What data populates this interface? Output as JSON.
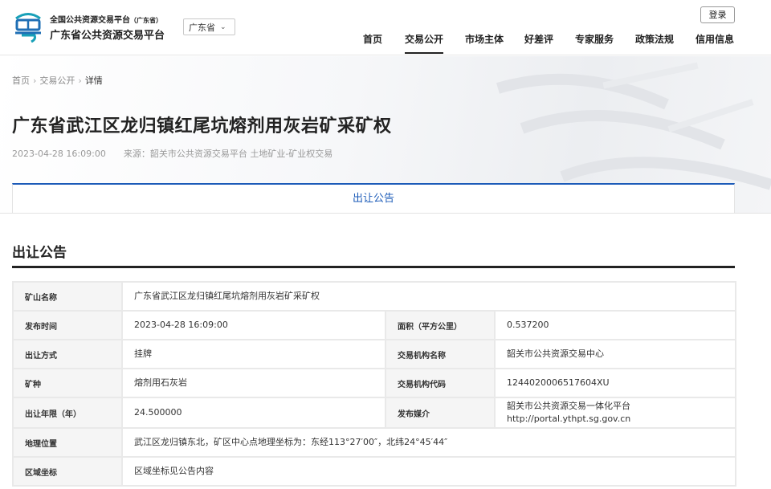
{
  "header": {
    "brand_sub": "全国公共资源交易平台",
    "brand_sub_province": "（广东省）",
    "brand_main": "广东省公共资源交易平台",
    "region": "广东省",
    "login": "登录",
    "nav": [
      "首页",
      "交易公开",
      "市场主体",
      "好差评",
      "专家服务",
      "政策法规",
      "信用信息"
    ],
    "active_nav": "交易公开"
  },
  "breadcrumb": {
    "home": "首页",
    "section": "交易公开",
    "current": "详情"
  },
  "article": {
    "title": "广东省武江区龙归镇红尾坑熔剂用灰岩矿采矿权",
    "datetime": "2023-04-28 16:09:00",
    "source": "来源：韶关市公共资源交易平台  土地矿业-矿业权交易"
  },
  "tab": {
    "label": "出让公告"
  },
  "section": {
    "title": "出让公告"
  },
  "details": {
    "mine_name_label": "矿山名称",
    "mine_name": "广东省武江区龙归镇红尾坑熔剂用灰岩矿采矿权",
    "publish_time_label": "发布时间",
    "publish_time": "2023-04-28 16:09:00",
    "area_label": "面积（平方公里）",
    "area": "0.537200",
    "method_label": "出让方式",
    "method": "挂牌",
    "agency_name_label": "交易机构名称",
    "agency_name": "韶关市公共资源交易中心",
    "mineral_label": "矿种",
    "mineral": "熔剂用石灰岩",
    "agency_code_label": "交易机构代码",
    "agency_code": "1244020006517604XU",
    "term_label": "出让年限（年）",
    "term": "24.500000",
    "media_label": "发布媒介",
    "media": "韶关市公共资源交易一体化平台 http://portal.ythpt.sg.gov.cn",
    "location_label": "地理位置",
    "location": "武江区龙归镇东北，矿区中心点地理坐标为：东经113°27′00″，北纬24°45′44″",
    "coords_label": "区域坐标",
    "coords": "区域坐标见公告内容"
  },
  "colors": {
    "accent": "#1c5bb8",
    "logo_blue": "#1f6fb5",
    "logo_teal": "#18a0b8"
  },
  "icons": {
    "logo": "yue-logo-icon",
    "dropdown": "chevron-down-icon"
  }
}
